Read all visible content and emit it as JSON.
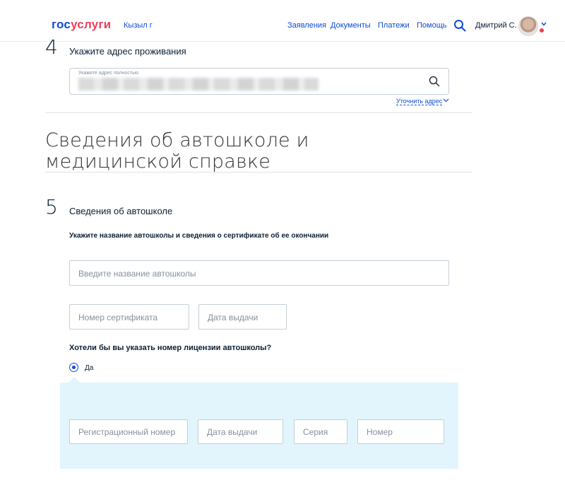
{
  "header": {
    "logo_part1": "гос",
    "logo_part2": "услуги",
    "location": "Кызыл г",
    "nav": [
      "Заявления",
      "Документы",
      "Платежи",
      "Помощь"
    ],
    "user_name": "Дмитрий С.",
    "colors": {
      "brand_blue": "#0d4cd3",
      "brand_red": "#ee3f58"
    }
  },
  "step4": {
    "number": "4",
    "title": "Укажите адрес проживания",
    "address_label": "Укажите адрес полностью",
    "refine_link": "Уточнить адрес"
  },
  "section": {
    "title": "Сведения об автошколе и медицинской справке"
  },
  "step5": {
    "number": "5",
    "title": "Сведения об автошколе",
    "instruction": "Укажите название автошколы и сведения о сертификате об ее окончании",
    "school_name_placeholder": "Введите название автошколы",
    "certificate_placeholder": "Номер сертификата",
    "issue_date_placeholder": "Дата выдачи",
    "question": "Хотели бы вы указать номер лицензии автошколы?",
    "radio_yes": "Да",
    "license": {
      "reg_number_placeholder": "Регистрационный номер",
      "issue_date_placeholder": "Дата выдачи",
      "series_placeholder": "Серия",
      "number_placeholder": "Номер"
    }
  }
}
